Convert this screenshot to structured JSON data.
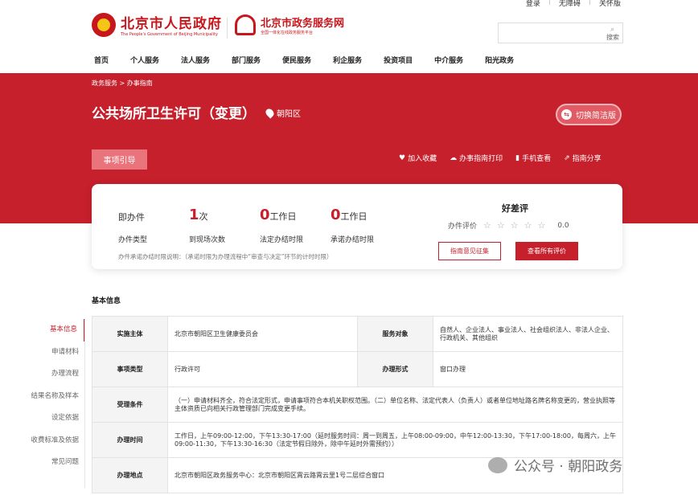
{
  "util_bar": {
    "login": "登录",
    "accessible": "无障碍",
    "about": "关怀版"
  },
  "header": {
    "gov_logo_title": "北京市人民政府",
    "gov_logo_subtitle": "The People's Government of Beijing Municipality",
    "service_logo_title": "北京市政务服务网",
    "service_logo_subtitle": "全国一体化在线政务服务平台",
    "search_label": "搜索"
  },
  "nav": [
    "首页",
    "个人服务",
    "法人服务",
    "部门服务",
    "便民服务",
    "利企服务",
    "投资项目",
    "中介服务",
    "阳光政务"
  ],
  "breadcrumb": "政务服务 > 办事指南",
  "page_title": "公共场所卫生许可（变更）",
  "location": "朝阳区",
  "switch_label": "切换简洁版",
  "guide_tab": "事项引导",
  "actions": [
    {
      "icon": "heart-icon",
      "label": "加入收藏"
    },
    {
      "icon": "cloud-print-icon",
      "label": "办事指南打印"
    },
    {
      "icon": "phone-icon",
      "label": "手机查看"
    },
    {
      "icon": "share-icon",
      "label": "指南分享"
    }
  ],
  "card": {
    "type_value": "即办件",
    "type_label": "办件类型",
    "visits_num": "1",
    "visits_unit": "次",
    "visits_label": "到现场次数",
    "legal_num": "0",
    "legal_unit": "工作日",
    "legal_label": "法定办结时限",
    "promise_num": "0",
    "promise_unit": "工作日",
    "promise_label": "承诺办结时限",
    "note": "办件承诺办结时限说明：（承诺时限为办理流程中“审查与决定”环节的计时时限）",
    "eval_title": "好差评",
    "eval_label": "办件评价",
    "eval_score": "0.0",
    "eval_stars": "☆☆☆☆☆",
    "btn_feedback": "指南意见征集",
    "btn_all_reviews": "查看所有评价"
  },
  "section_title": "基本信息",
  "side_nav": [
    "基本信息",
    "申请材料",
    "办理流程",
    "结果名称及样本",
    "设定依据",
    "收费标准及依据",
    "常见问题"
  ],
  "table": {
    "r1": {
      "h1": "实施主体",
      "v1": "北京市朝阳区卫生健康委员会",
      "h2": "服务对象",
      "v2": "自然人、企业法人、事业法人、社会组织法人、非法人企业、行政机关、其他组织"
    },
    "r2": {
      "h1": "事项类型",
      "v1": "行政许可",
      "h2": "办理形式",
      "v2": "窗口办理"
    },
    "r3": {
      "h": "受理条件",
      "v": "（一）申请材料齐全，符合法定形式，申请事项符合本机关职权范围。（二）单位名称、法定代表人（负责人）或者单位地址路名牌名称变更的，营业执照等主体资质已向相关行政管理部门完成变更手续。"
    },
    "r4": {
      "h": "办理时间",
      "v": "工作日，上午09:00-12:00，下午13:30-17:00（延时服务时间：周一到周五，上午08:00-09:00，中午12:00-13:30，下午17:00-18:00，每周六，上午09:00-11:30，下午13:30-16:30（法定节假日除外，除中午延时外需预约））"
    },
    "r5": {
      "h": "办理地点",
      "v": "北京市朝阳区政务服务中心：北京市朝阳区霄云路霄云里1号二层综合窗口"
    }
  },
  "watermark": "公众号 · 朝阳政务"
}
